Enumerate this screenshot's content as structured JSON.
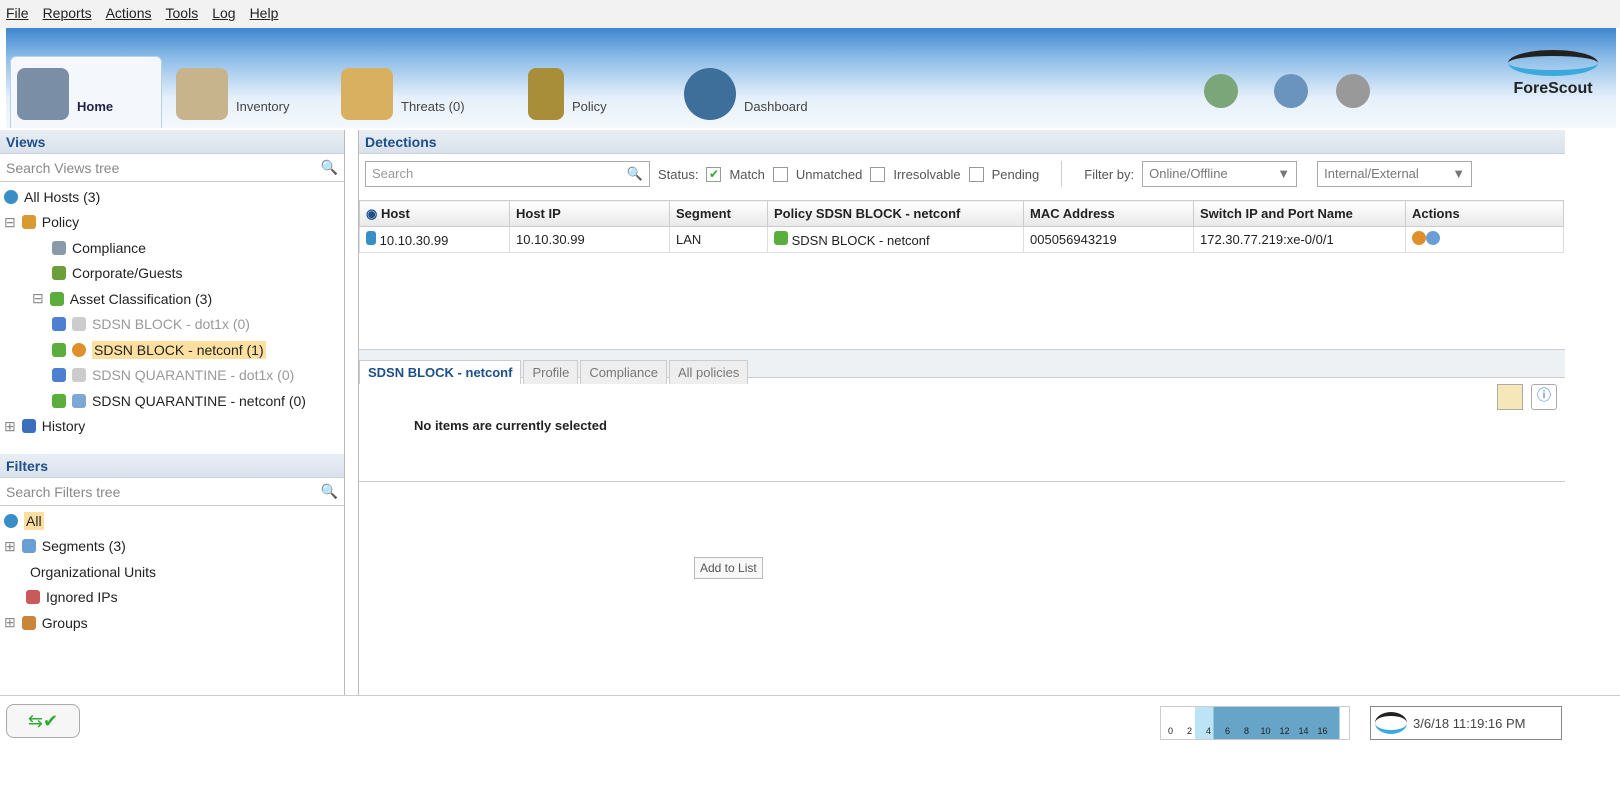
{
  "menu": [
    "File",
    "Reports",
    "Actions",
    "Tools",
    "Log",
    "Help"
  ],
  "tabs": [
    {
      "label": "Home"
    },
    {
      "label": "Inventory"
    },
    {
      "label": "Threats (0)"
    },
    {
      "label": "Policy"
    },
    {
      "label": "Dashboard"
    }
  ],
  "brand": "ForeScout",
  "views": {
    "title": "Views",
    "search_placeholder": "Search Views tree",
    "items": [
      {
        "label": "All Hosts (3)"
      },
      {
        "label": "Policy"
      },
      {
        "label": "Compliance"
      },
      {
        "label": "Corporate/Guests"
      },
      {
        "label": "Asset Classification (3)"
      },
      {
        "label": "SDSN BLOCK - dot1x (0)"
      },
      {
        "label": "SDSN BLOCK - netconf (1)"
      },
      {
        "label": "SDSN QUARANTINE - dot1x (0)"
      },
      {
        "label": "SDSN QUARANTINE - netconf (0)"
      },
      {
        "label": "History"
      }
    ]
  },
  "filters": {
    "title": "Filters",
    "search_placeholder": "Search Filters tree",
    "items": [
      {
        "label": "All"
      },
      {
        "label": "Segments (3)"
      },
      {
        "label": "Organizational Units"
      },
      {
        "label": "Ignored IPs"
      },
      {
        "label": "Groups"
      }
    ]
  },
  "detections": {
    "title": "Detections",
    "search_placeholder": "Search",
    "status_label": "Status:",
    "statuses": [
      {
        "label": "Match",
        "checked": true
      },
      {
        "label": "Unmatched",
        "checked": false
      },
      {
        "label": "Irresolvable",
        "checked": false
      },
      {
        "label": "Pending",
        "checked": false
      }
    ],
    "filter_by_label": "Filter by:",
    "filter1": "Online/Offline",
    "filter2": "Internal/External",
    "columns": [
      "Host",
      "Host IP",
      "Segment",
      "Policy SDSN BLOCK - netconf",
      "MAC Address",
      "Switch IP and Port Name",
      "Actions"
    ],
    "rows": [
      {
        "host": "10.10.30.99",
        "ip": "10.10.30.99",
        "segment": "LAN",
        "policy": "SDSN BLOCK - netconf",
        "mac": "005056943219",
        "switch": "172.30.77.219:xe-0/0/1"
      }
    ]
  },
  "details": {
    "tabs": [
      "SDSN BLOCK - netconf",
      "Profile",
      "Compliance",
      "All policies"
    ],
    "empty": "No items are currently selected",
    "add_button": "Add to List"
  },
  "statusbar": {
    "scale": [
      "0",
      "2",
      "4",
      "6",
      "8",
      "10",
      "12",
      "14",
      "16"
    ],
    "datetime": "3/6/18 11:19:16 PM"
  }
}
